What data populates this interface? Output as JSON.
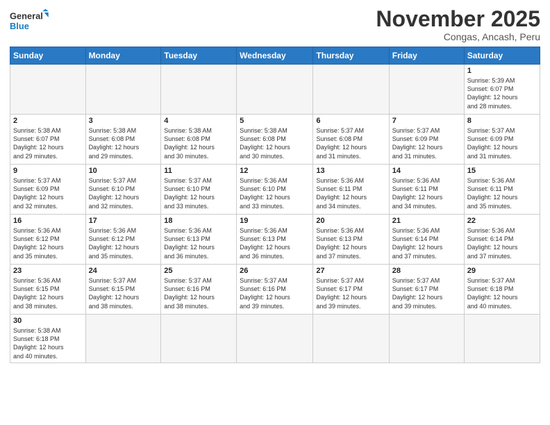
{
  "header": {
    "logo_general": "General",
    "logo_blue": "Blue",
    "month_title": "November 2025",
    "subtitle": "Congas, Ancash, Peru"
  },
  "days_of_week": [
    "Sunday",
    "Monday",
    "Tuesday",
    "Wednesday",
    "Thursday",
    "Friday",
    "Saturday"
  ],
  "weeks": [
    [
      {
        "day": "",
        "info": ""
      },
      {
        "day": "",
        "info": ""
      },
      {
        "day": "",
        "info": ""
      },
      {
        "day": "",
        "info": ""
      },
      {
        "day": "",
        "info": ""
      },
      {
        "day": "",
        "info": ""
      },
      {
        "day": "1",
        "info": "Sunrise: 5:39 AM\nSunset: 6:07 PM\nDaylight: 12 hours\nand 28 minutes."
      }
    ],
    [
      {
        "day": "2",
        "info": "Sunrise: 5:38 AM\nSunset: 6:07 PM\nDaylight: 12 hours\nand 29 minutes."
      },
      {
        "day": "3",
        "info": "Sunrise: 5:38 AM\nSunset: 6:08 PM\nDaylight: 12 hours\nand 29 minutes."
      },
      {
        "day": "4",
        "info": "Sunrise: 5:38 AM\nSunset: 6:08 PM\nDaylight: 12 hours\nand 30 minutes."
      },
      {
        "day": "5",
        "info": "Sunrise: 5:38 AM\nSunset: 6:08 PM\nDaylight: 12 hours\nand 30 minutes."
      },
      {
        "day": "6",
        "info": "Sunrise: 5:37 AM\nSunset: 6:08 PM\nDaylight: 12 hours\nand 31 minutes."
      },
      {
        "day": "7",
        "info": "Sunrise: 5:37 AM\nSunset: 6:09 PM\nDaylight: 12 hours\nand 31 minutes."
      },
      {
        "day": "8",
        "info": "Sunrise: 5:37 AM\nSunset: 6:09 PM\nDaylight: 12 hours\nand 31 minutes."
      }
    ],
    [
      {
        "day": "9",
        "info": "Sunrise: 5:37 AM\nSunset: 6:09 PM\nDaylight: 12 hours\nand 32 minutes."
      },
      {
        "day": "10",
        "info": "Sunrise: 5:37 AM\nSunset: 6:10 PM\nDaylight: 12 hours\nand 32 minutes."
      },
      {
        "day": "11",
        "info": "Sunrise: 5:37 AM\nSunset: 6:10 PM\nDaylight: 12 hours\nand 33 minutes."
      },
      {
        "day": "12",
        "info": "Sunrise: 5:36 AM\nSunset: 6:10 PM\nDaylight: 12 hours\nand 33 minutes."
      },
      {
        "day": "13",
        "info": "Sunrise: 5:36 AM\nSunset: 6:11 PM\nDaylight: 12 hours\nand 34 minutes."
      },
      {
        "day": "14",
        "info": "Sunrise: 5:36 AM\nSunset: 6:11 PM\nDaylight: 12 hours\nand 34 minutes."
      },
      {
        "day": "15",
        "info": "Sunrise: 5:36 AM\nSunset: 6:11 PM\nDaylight: 12 hours\nand 35 minutes."
      }
    ],
    [
      {
        "day": "16",
        "info": "Sunrise: 5:36 AM\nSunset: 6:12 PM\nDaylight: 12 hours\nand 35 minutes."
      },
      {
        "day": "17",
        "info": "Sunrise: 5:36 AM\nSunset: 6:12 PM\nDaylight: 12 hours\nand 35 minutes."
      },
      {
        "day": "18",
        "info": "Sunrise: 5:36 AM\nSunset: 6:13 PM\nDaylight: 12 hours\nand 36 minutes."
      },
      {
        "day": "19",
        "info": "Sunrise: 5:36 AM\nSunset: 6:13 PM\nDaylight: 12 hours\nand 36 minutes."
      },
      {
        "day": "20",
        "info": "Sunrise: 5:36 AM\nSunset: 6:13 PM\nDaylight: 12 hours\nand 37 minutes."
      },
      {
        "day": "21",
        "info": "Sunrise: 5:36 AM\nSunset: 6:14 PM\nDaylight: 12 hours\nand 37 minutes."
      },
      {
        "day": "22",
        "info": "Sunrise: 5:36 AM\nSunset: 6:14 PM\nDaylight: 12 hours\nand 37 minutes."
      }
    ],
    [
      {
        "day": "23",
        "info": "Sunrise: 5:36 AM\nSunset: 6:15 PM\nDaylight: 12 hours\nand 38 minutes."
      },
      {
        "day": "24",
        "info": "Sunrise: 5:37 AM\nSunset: 6:15 PM\nDaylight: 12 hours\nand 38 minutes."
      },
      {
        "day": "25",
        "info": "Sunrise: 5:37 AM\nSunset: 6:16 PM\nDaylight: 12 hours\nand 38 minutes."
      },
      {
        "day": "26",
        "info": "Sunrise: 5:37 AM\nSunset: 6:16 PM\nDaylight: 12 hours\nand 39 minutes."
      },
      {
        "day": "27",
        "info": "Sunrise: 5:37 AM\nSunset: 6:17 PM\nDaylight: 12 hours\nand 39 minutes."
      },
      {
        "day": "28",
        "info": "Sunrise: 5:37 AM\nSunset: 6:17 PM\nDaylight: 12 hours\nand 39 minutes."
      },
      {
        "day": "29",
        "info": "Sunrise: 5:37 AM\nSunset: 6:18 PM\nDaylight: 12 hours\nand 40 minutes."
      }
    ],
    [
      {
        "day": "30",
        "info": "Sunrise: 5:38 AM\nSunset: 6:18 PM\nDaylight: 12 hours\nand 40 minutes."
      },
      {
        "day": "",
        "info": ""
      },
      {
        "day": "",
        "info": ""
      },
      {
        "day": "",
        "info": ""
      },
      {
        "day": "",
        "info": ""
      },
      {
        "day": "",
        "info": ""
      },
      {
        "day": "",
        "info": ""
      }
    ]
  ]
}
